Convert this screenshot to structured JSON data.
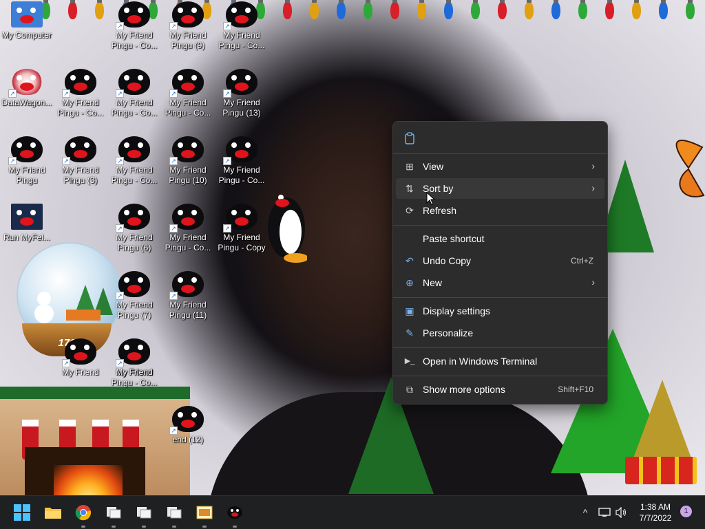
{
  "desktop": {
    "icons": [
      {
        "label": "My Computer",
        "type": "computer"
      },
      {
        "label": "DataWagon...",
        "type": "datawagon"
      },
      {
        "label": "My Friend Pingu",
        "type": "pingu"
      },
      {
        "label": "Run MyFel...",
        "type": "cat"
      },
      {
        "label": "My Friend Pingu - Co...",
        "type": "pingu"
      },
      {
        "label": "My Friend Pingu (3)",
        "type": "pingu"
      },
      {
        "label": "My Friend Pingu - Co...",
        "type": "pingu"
      },
      {
        "label": "My Friend Pingu (6)",
        "type": "pingu"
      },
      {
        "label": "My Friend Pingu - Co...",
        "type": "pingu"
      },
      {
        "label": "My Friend Pingu (7)",
        "type": "pingu"
      },
      {
        "label": "My Friend Pingu - Co...",
        "type": "pingu"
      },
      {
        "label": "My Friend",
        "type": "pingu"
      },
      {
        "label": "My Friend Pingu (9)",
        "type": "pingu"
      },
      {
        "label": "My Friend Pingu - Co...",
        "type": "pingu"
      },
      {
        "label": "My Friend Pingu (10)",
        "type": "pingu"
      },
      {
        "label": "My Friend Pingu - Co...",
        "type": "pingu"
      },
      {
        "label": "My Friend Pingu (11)",
        "type": "pingu"
      },
      {
        "label": "My Friend Pingu - Co...",
        "type": "pingu"
      },
      {
        "label": "My Friend Pingu - Co...",
        "type": "pingu"
      },
      {
        "label": "My Friend Pingu (13)",
        "type": "pingu"
      },
      {
        "label": "My Friend Pingu - Co...",
        "type": "pingu"
      },
      {
        "label": "My Friend Pingu - Copy",
        "type": "pingu"
      },
      {
        "label": "My Friend",
        "type": "pingu"
      },
      {
        "label": "end (12)",
        "type": "pingu"
      }
    ],
    "snowglobe_label": "170",
    "light_colors": [
      "#2fa83a",
      "#d81e28",
      "#e0a010",
      "#1e6ad8",
      "#2fa83a",
      "#d81e28",
      "#e0a010",
      "#1e6ad8"
    ]
  },
  "context_menu": {
    "top_icon": "clipboard-icon",
    "items": [
      {
        "label": "View",
        "icon": "grid-icon",
        "shortcut": "",
        "submenu": true
      },
      {
        "label": "Sort by",
        "icon": "sort-icon",
        "shortcut": "",
        "submenu": true,
        "hovered": true
      },
      {
        "label": "Refresh",
        "icon": "refresh-icon",
        "shortcut": "",
        "submenu": false
      },
      {
        "label": "Paste shortcut",
        "icon": "",
        "shortcut": "",
        "submenu": false
      },
      {
        "label": "Undo Copy",
        "icon": "undo-icon",
        "shortcut": "Ctrl+Z",
        "submenu": false
      },
      {
        "label": "New",
        "icon": "plus-circle-icon",
        "shortcut": "",
        "submenu": true
      },
      {
        "label": "Display settings",
        "icon": "display-icon",
        "shortcut": "",
        "submenu": false
      },
      {
        "label": "Personalize",
        "icon": "pencil-icon",
        "shortcut": "",
        "submenu": false
      },
      {
        "label": "Open in Windows Terminal",
        "icon": "terminal-icon",
        "shortcut": "",
        "submenu": false
      },
      {
        "label": "Show more options",
        "icon": "more-options-icon",
        "shortcut": "Shift+F10",
        "submenu": false
      }
    ]
  },
  "taskbar": {
    "apps": [
      {
        "name": "start-button",
        "icon": "windows-icon"
      },
      {
        "name": "file-explorer",
        "icon": "folder-icon"
      },
      {
        "name": "chrome",
        "icon": "chrome-icon"
      },
      {
        "name": "app-window-1",
        "icon": "window-icon"
      },
      {
        "name": "app-window-2",
        "icon": "window-icon"
      },
      {
        "name": "app-window-3",
        "icon": "window-icon"
      },
      {
        "name": "image-viewer",
        "icon": "image-icon"
      },
      {
        "name": "pingu-app",
        "icon": "pingu-icon"
      }
    ],
    "tray": {
      "chevron": "^",
      "time": "1:38 AM",
      "date": "7/7/2022",
      "notification_count": "1"
    }
  }
}
